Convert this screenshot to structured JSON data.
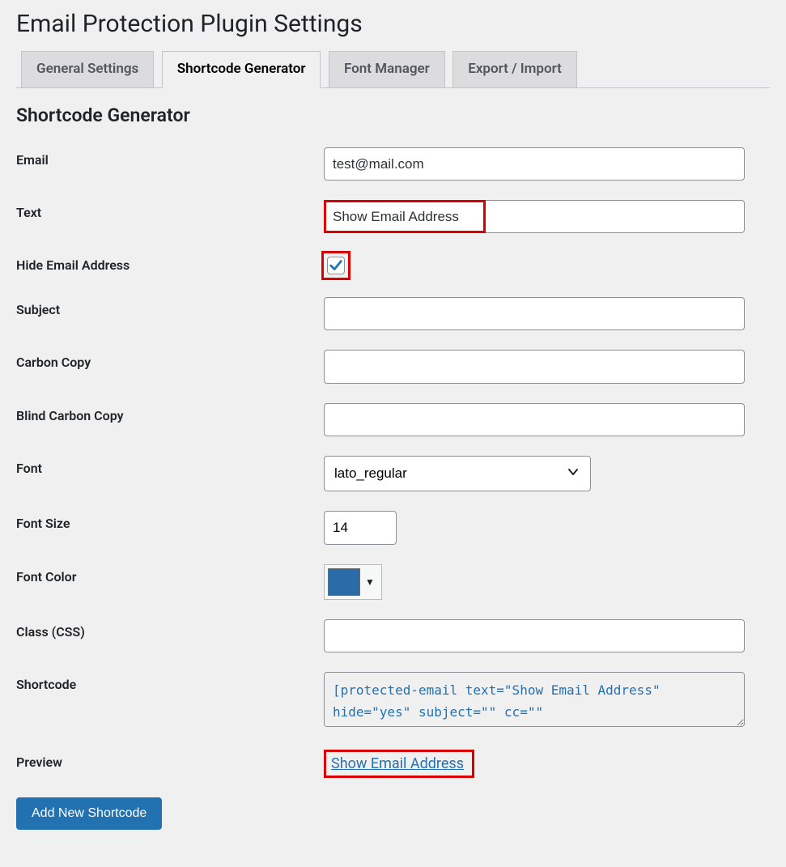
{
  "page": {
    "title": "Email Protection Plugin Settings"
  },
  "tabs": [
    {
      "label": "General Settings",
      "active": false
    },
    {
      "label": "Shortcode Generator",
      "active": true
    },
    {
      "label": "Font Manager",
      "active": false
    },
    {
      "label": "Export / Import",
      "active": false
    }
  ],
  "section": {
    "title": "Shortcode Generator"
  },
  "fields": {
    "email": {
      "label": "Email",
      "value": "test@mail.com"
    },
    "text": {
      "label": "Text",
      "value": "Show Email Address"
    },
    "hide": {
      "label": "Hide Email Address",
      "checked": true
    },
    "subject": {
      "label": "Subject",
      "value": ""
    },
    "cc": {
      "label": "Carbon Copy",
      "value": ""
    },
    "bcc": {
      "label": "Blind Carbon Copy",
      "value": ""
    },
    "font": {
      "label": "Font",
      "value": "lato_regular"
    },
    "font_size": {
      "label": "Font Size",
      "value": "14"
    },
    "font_color": {
      "label": "Font Color",
      "value": "#2a6ba8"
    },
    "css_class": {
      "label": "Class (CSS)",
      "value": ""
    },
    "shortcode": {
      "label": "Shortcode",
      "value": "[protected-email text=\"Show Email Address\" hide=\"yes\" subject=\"\" cc=\"\""
    },
    "preview": {
      "label": "Preview",
      "value": "Show Email Address"
    }
  },
  "buttons": {
    "add_new": "Add New Shortcode"
  }
}
